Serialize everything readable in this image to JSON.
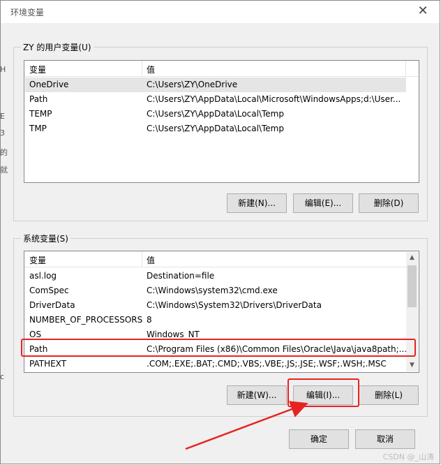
{
  "window": {
    "title": "环境变量",
    "close_glyph": "✕"
  },
  "user_vars": {
    "group_label": "ZY 的用户变量(U)",
    "columns": [
      "变量",
      "值"
    ],
    "rows": [
      {
        "name": "OneDrive",
        "value": "C:\\Users\\ZY\\OneDrive"
      },
      {
        "name": "Path",
        "value": "C:\\Users\\ZY\\AppData\\Local\\Microsoft\\WindowsApps;d:\\User..."
      },
      {
        "name": "TEMP",
        "value": "C:\\Users\\ZY\\AppData\\Local\\Temp"
      },
      {
        "name": "TMP",
        "value": "C:\\Users\\ZY\\AppData\\Local\\Temp"
      }
    ],
    "buttons": {
      "new": "新建(N)...",
      "edit": "编辑(E)...",
      "delete": "删除(D)"
    }
  },
  "system_vars": {
    "group_label": "系统变量(S)",
    "columns": [
      "变量",
      "值"
    ],
    "rows": [
      {
        "name": "asl.log",
        "value": "Destination=file"
      },
      {
        "name": "ComSpec",
        "value": "C:\\Windows\\system32\\cmd.exe"
      },
      {
        "name": "DriverData",
        "value": "C:\\Windows\\System32\\Drivers\\DriverData"
      },
      {
        "name": "NUMBER_OF_PROCESSORS",
        "value": "8"
      },
      {
        "name": "OS",
        "value": "Windows_NT"
      },
      {
        "name": "Path",
        "value": "C:\\Program Files (x86)\\Common Files\\Oracle\\Java\\java8path;..."
      },
      {
        "name": "PATHEXT",
        "value": ".COM;.EXE;.BAT;.CMD;.VBS;.VBE;.JS;.JSE;.WSF;.WSH;.MSC"
      }
    ],
    "buttons": {
      "new": "新建(W)...",
      "edit": "编辑(I)...",
      "delete": "删除(L)"
    }
  },
  "footer": {
    "ok": "确定",
    "cancel": "取消"
  },
  "annotation": {
    "color": "#e8231f"
  },
  "background_fragments": [
    "H",
    "E",
    "3",
    "的",
    "就",
    "c"
  ],
  "watermark": "CSDN @_山涛"
}
